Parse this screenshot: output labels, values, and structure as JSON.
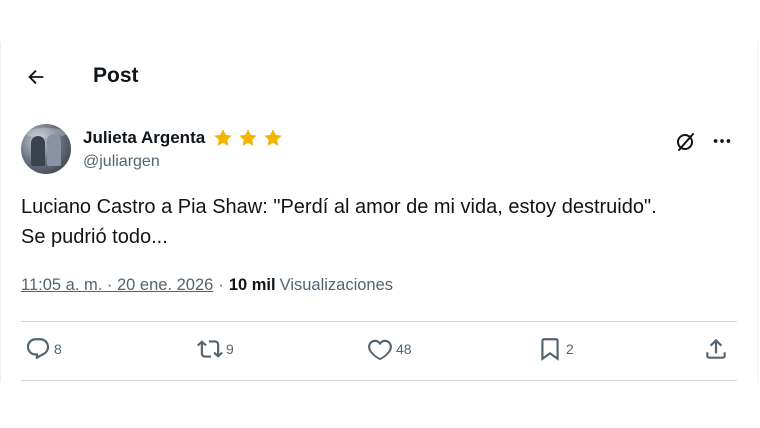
{
  "header": {
    "title": "Post"
  },
  "author": {
    "name": "Julieta Argenta",
    "handle": "@juliargen",
    "stars_count": 3
  },
  "tweet": {
    "text_line1": "Luciano Castro a Pia Shaw: \"Perdí al amor de mi vida, estoy destruido\".",
    "text_line2": "Se pudrió todo..."
  },
  "meta": {
    "time": "11:05 a. m. · 20 ene. 2026",
    "separator": "·",
    "views_count": "10 mil",
    "views_label": "Visualizaciones"
  },
  "actions": {
    "replies": "8",
    "reposts": "9",
    "likes": "48",
    "bookmarks": "2"
  },
  "colors": {
    "text": "#0f1419",
    "secondary": "#536471",
    "star": "#f4b400",
    "divider": "#cfd9de"
  },
  "icons": [
    "back-arrow-icon",
    "grok-icon",
    "more-icon",
    "reply-icon",
    "repost-icon",
    "like-icon",
    "bookmark-icon",
    "share-icon",
    "star-icon"
  ]
}
